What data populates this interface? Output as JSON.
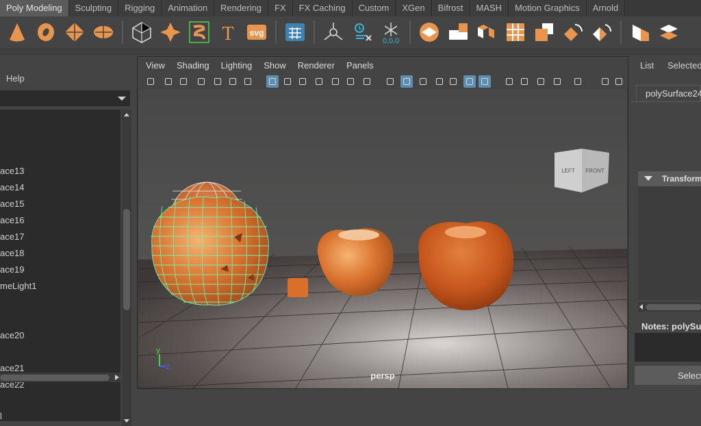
{
  "shelf_tabs": [
    "Poly Modeling",
    "Sculpting",
    "Rigging",
    "Animation",
    "Rendering",
    "FX",
    "FX Caching",
    "Custom",
    "XGen",
    "Bifrost",
    "MASH",
    "Motion Graphics",
    "Arnold"
  ],
  "active_shelf_tab": "Poly Modeling",
  "shelf_icons": [
    "cone-icon",
    "torus-icon",
    "diamond-icon",
    "disc-icon",
    "sep",
    "platonic-icon",
    "sweep-mesh-icon",
    "super-shape-icon",
    "type-text-icon",
    "svg-icon",
    "sep",
    "grid-uv-icon",
    "sep",
    "pivot-icon",
    "move-tool-icon",
    "snowflake-icon",
    "sep",
    "combine-icon",
    "extract-icon",
    "separate-icon",
    "grid-icon",
    "merge-icon",
    "smooth-icon",
    "mirror-icon",
    "sep",
    "bevel-icon",
    "bridge-icon"
  ],
  "shelf_text": {
    "type_glyph": "T",
    "svg_glyph": "svg",
    "coords_glyph": "0,0,0"
  },
  "outliner": {
    "menu_help": "Help",
    "items": [
      "ace13",
      "ace14",
      "ace15",
      "ace16",
      "ace17",
      "ace18",
      "ace19",
      "meLight1",
      "ace20",
      "ace21",
      "ace22",
      "l"
    ]
  },
  "viewport": {
    "menu": [
      "View",
      "Shading",
      "Lighting",
      "Show",
      "Renderer",
      "Panels"
    ],
    "camera_label": "persp",
    "view_cube": {
      "left": "LEFT",
      "front": "FRONT"
    },
    "axis": {
      "y": "y",
      "z": "z"
    }
  },
  "attribute_editor": {
    "tabs": [
      "List",
      "Selected"
    ],
    "node_tab": "polySurface24",
    "section": "Transform",
    "notes_label": "Notes: polySu",
    "select_button": "Select"
  },
  "colors": {
    "accent_orange": "#e8954f",
    "selection_green": "#6ef2b0",
    "active_tab": "#5b5b5b",
    "tool_on": "#5e8fb3"
  }
}
